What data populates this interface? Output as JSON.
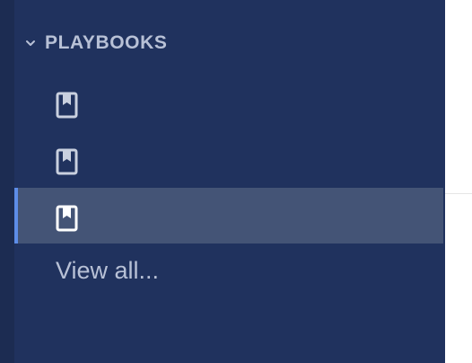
{
  "sidebar": {
    "section": {
      "title": "PLAYBOOKS",
      "chevron_icon": "chevron-down-icon"
    },
    "items": [
      {
        "icon": "book-icon",
        "active": false
      },
      {
        "icon": "book-icon",
        "active": false
      },
      {
        "icon": "book-icon",
        "active": true
      }
    ],
    "view_all_label": "View all..."
  },
  "colors": {
    "sidebar_bg": "#20325e",
    "rail_bg": "#1c2c52",
    "active_bg": "#445476",
    "active_indicator": "#5d8de8",
    "text_muted": "#b8c1d6",
    "icon_color": "#c9d0df"
  }
}
